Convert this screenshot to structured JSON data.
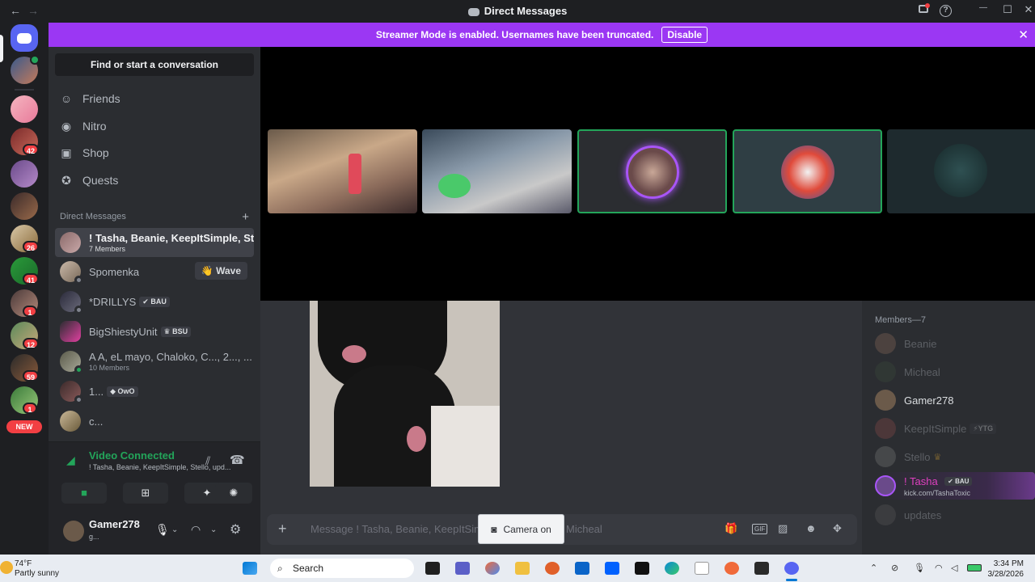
{
  "window": {
    "title": "Direct Messages",
    "nav_back": "←",
    "nav_forward": "→",
    "help_icon": "?",
    "minimize": "—",
    "maximize": "☐",
    "close": "✕"
  },
  "guild_badges": [
    "42",
    "26",
    "41",
    "1",
    "12",
    "59",
    "1",
    "NEW"
  ],
  "banner": {
    "text": "Streamer Mode is enabled. Usernames have been truncated.",
    "button": "Disable",
    "close": "✕"
  },
  "sidebar": {
    "search_placeholder": "Find or start a conversation",
    "nav": [
      {
        "label": "Friends",
        "icon": "friends-icon"
      },
      {
        "label": "Nitro",
        "icon": "nitro-icon"
      },
      {
        "label": "Shop",
        "icon": "shop-icon"
      },
      {
        "label": "Quests",
        "icon": "quests-icon"
      }
    ],
    "dm_header": "Direct Messages",
    "dm_add": "+",
    "dms": [
      {
        "name": "! Tasha, Beanie, KeepItSimple, St...",
        "sub": "7 Members"
      },
      {
        "name": "Spomenka",
        "action": "👋 Wave"
      },
      {
        "name": "*DRILLYS",
        "tag": "✔ BAU"
      },
      {
        "name": "BigShiestyUnit",
        "tag": "♛ BSU"
      },
      {
        "name": "A A, eL mayo, Chaloko, C..., 2..., ...",
        "sub": "10 Members"
      },
      {
        "name": "1...",
        "tag": "◆ OwO"
      },
      {
        "name": "c..."
      }
    ]
  },
  "voice": {
    "status": "Video Connected",
    "channel": "! Tasha, Beanie, KeepItSimple, Stello, upd...",
    "buttons": [
      "■",
      "⊞",
      "✦",
      "✺"
    ]
  },
  "user": {
    "name": "Gamer278",
    "status": "g..."
  },
  "members": {
    "header": "Members—7",
    "list": [
      {
        "name": "Beanie",
        "dim": true
      },
      {
        "name": "Micheal",
        "dim": true
      },
      {
        "name": "Gamer278",
        "dim": false
      },
      {
        "name": "KeepItSimple",
        "dim": true,
        "tag": "⚡YTG"
      },
      {
        "name": "Stello",
        "dim": true,
        "tag": "♛"
      },
      {
        "name": "! Tasha",
        "dim": false,
        "tag": "✔ BAU",
        "sub": "kick.com/TashaToxic"
      },
      {
        "name": "updates",
        "dim": true
      }
    ]
  },
  "message_bar": {
    "placeholder": "Message ! Tasha, Beanie, KeepItSimp",
    "placeholder_tail": "Micheal",
    "add": "+"
  },
  "camera_tooltip": "Camera on",
  "taskbar": {
    "temp": "74°F",
    "weather": "Partly sunny",
    "search": "Search",
    "time": "3:34 PM",
    "date": "3/28/2026"
  },
  "colors": {
    "banner": "#9b37f3",
    "voice_connected": "#23a55a",
    "badge": "#f23f43"
  }
}
